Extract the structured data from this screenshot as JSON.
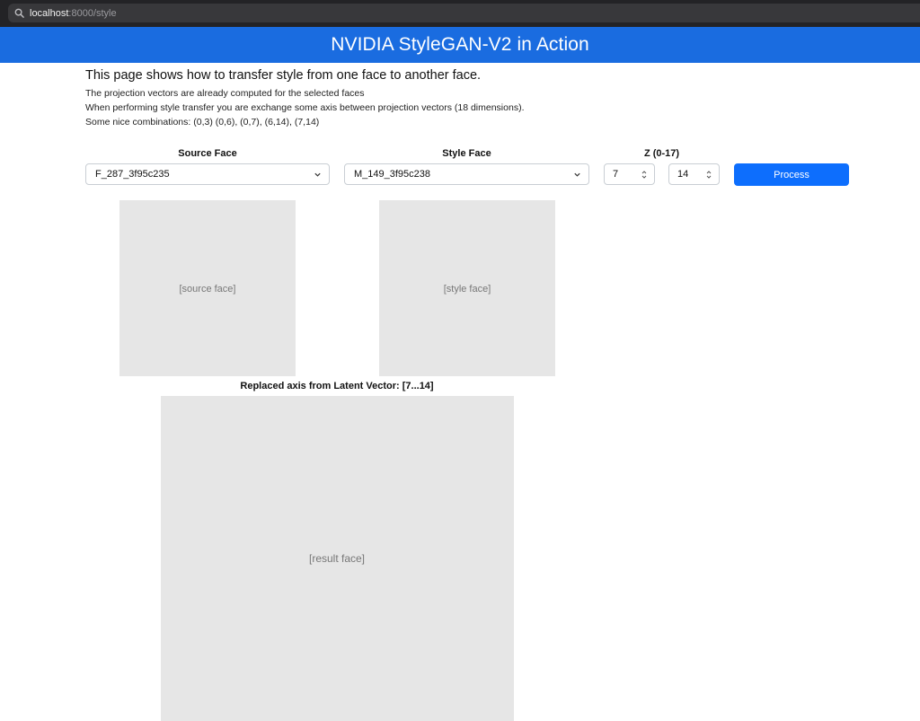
{
  "browser": {
    "url_host": "localhost",
    "url_rest": ":8000/style"
  },
  "header": {
    "title": "NVIDIA StyleGAN-V2 in Action"
  },
  "intro": {
    "heading": "This page shows how to transfer style from one face to another face.",
    "lines": [
      "The projection vectors are already computed for the selected faces",
      "When performing style transfer you are exchange some axis between projection vectors (18 dimensions).",
      "Some nice combinations: (0,3) (0,6), (0,7), (6,14), (7,14)"
    ]
  },
  "controls": {
    "source_label": "Source Face",
    "source_value": "F_287_3f95c235",
    "style_label": "Style Face",
    "style_value": "M_149_3f95c238",
    "z_label": "Z (0-17)",
    "z_start": "7",
    "z_end": "14",
    "process_label": "Process"
  },
  "result": {
    "label": "Replaced axis from Latent Vector: [7...14]"
  },
  "colors": {
    "header_bg": "#1a6ce0",
    "button_bg": "#0d6efd"
  },
  "icons": {
    "search": "search-icon",
    "chevron": "chevron-down-icon",
    "spinner": "spinner-arrows-icon"
  }
}
